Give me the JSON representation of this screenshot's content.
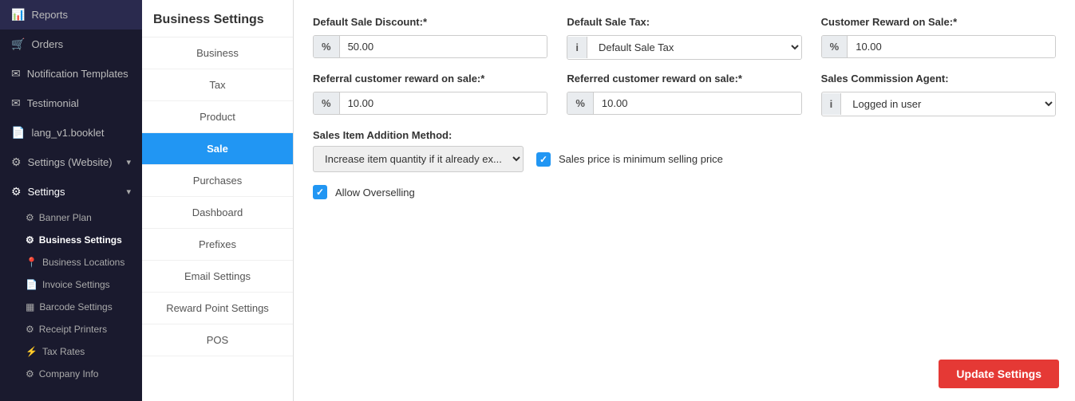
{
  "sidebar": {
    "items": [
      {
        "label": "Reports",
        "icon": "📊",
        "active": false
      },
      {
        "label": "Orders",
        "icon": "🛒",
        "active": false
      },
      {
        "label": "Notification Templates",
        "icon": "✉",
        "active": false
      },
      {
        "label": "Testimonial",
        "icon": "✉",
        "active": false
      },
      {
        "label": "lang_v1.booklet",
        "icon": "📄",
        "active": false
      },
      {
        "label": "Settings (Website)",
        "icon": "⚙",
        "active": false,
        "toggle": "▾"
      },
      {
        "label": "Settings",
        "icon": "⚙",
        "active": true,
        "toggle": "▾"
      }
    ],
    "sub_items": [
      {
        "label": "Banner Plan",
        "icon": "⚙",
        "active": false
      },
      {
        "label": "Business Settings",
        "icon": "⚙",
        "active": true
      },
      {
        "label": "Business Locations",
        "icon": "📍",
        "active": false
      },
      {
        "label": "Invoice Settings",
        "icon": "📄",
        "active": false
      },
      {
        "label": "Barcode Settings",
        "icon": "▦",
        "active": false
      },
      {
        "label": "Receipt Printers",
        "icon": "⚙",
        "active": false
      },
      {
        "label": "Tax Rates",
        "icon": "⚡",
        "active": false
      },
      {
        "label": "Company Info",
        "icon": "⚙",
        "active": false
      }
    ]
  },
  "middle_panel": {
    "header": "Business Settings",
    "nav_items": [
      {
        "label": "Business",
        "active": false
      },
      {
        "label": "Tax",
        "active": false
      },
      {
        "label": "Product",
        "active": false
      },
      {
        "label": "Sale",
        "active": true
      },
      {
        "label": "Purchases",
        "active": false
      },
      {
        "label": "Dashboard",
        "active": false
      },
      {
        "label": "Prefixes",
        "active": false
      },
      {
        "label": "Email Settings",
        "active": false
      },
      {
        "label": "Reward Point Settings",
        "active": false
      },
      {
        "label": "POS",
        "active": false
      }
    ]
  },
  "main": {
    "fields": {
      "default_sale_discount": {
        "label": "Default Sale Discount:*",
        "prefix": "%",
        "value": "50.00"
      },
      "default_sale_tax": {
        "label": "Default Sale Tax:",
        "prefix_icon": "i",
        "value": "Default Sale Tax",
        "has_dropdown": true
      },
      "customer_reward_on_sale": {
        "label": "Customer Reward on Sale:*",
        "prefix": "%",
        "value": "10.00"
      },
      "referral_customer_reward": {
        "label": "Referral customer reward on sale:*",
        "prefix": "%",
        "value": "10.00"
      },
      "referred_customer_reward": {
        "label": "Referred customer reward on sale:*",
        "prefix": "%",
        "value": "10.00"
      },
      "sales_commission_agent": {
        "label": "Sales Commission Agent:",
        "prefix_icon": "i",
        "value": "Logged in user",
        "has_dropdown": true
      },
      "sales_item_addition_method": {
        "label": "Sales Item Addition Method:",
        "value": "Increase item quantity if it already ex...",
        "has_dropdown": true
      }
    },
    "checkboxes": [
      {
        "label": "Sales price is minimum selling price",
        "checked": true
      },
      {
        "label": "Allow Overselling",
        "checked": true
      }
    ],
    "update_button": "Update Settings"
  }
}
